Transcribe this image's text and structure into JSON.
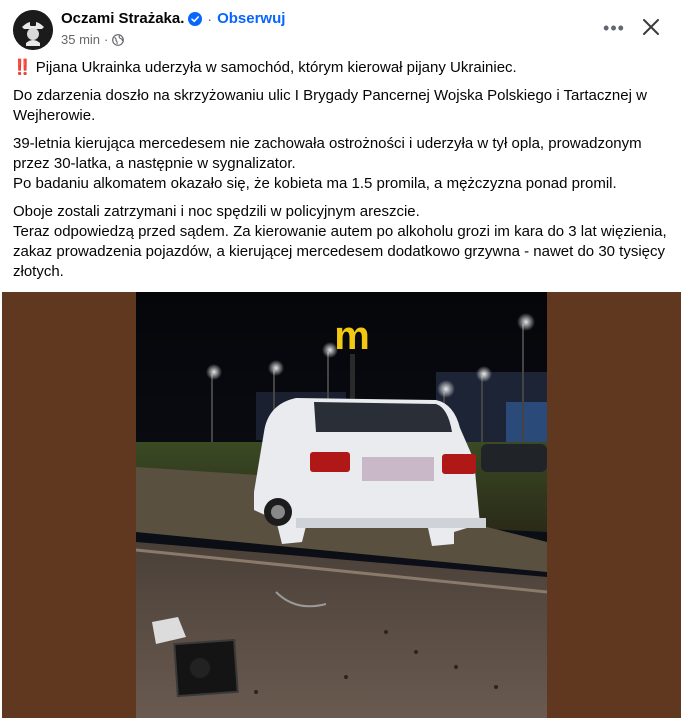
{
  "header": {
    "page_name": "Oczami Strażaka.",
    "follow_label": "Obserwuj",
    "separator": "·",
    "time": "35 min",
    "time_separator": "·",
    "verified_icon": "verified-badge-icon",
    "privacy_icon": "globe-icon",
    "more_label": "•••",
    "close_icon": "close-icon"
  },
  "post": {
    "headline": "Pijana Ukrainka uderzyła w samochód, którym kierował pijany Ukrainiec.",
    "headline_icon": "‼️",
    "paragraph1": "Do zdarzenia doszło na skrzyżowaniu ulic I Brygady Pancernej Wojska Polskiego i Tartacznej w Wejherowie.",
    "paragraph2_lines": [
      "39-letnia kierująca mercedesem nie zachowała ostrożności i uderzyła w tył opla, prowadzonym przez 30-latka, a następnie w sygnalizator.",
      "Po badaniu alkomatem okazało się, że kobieta ma 1.5 promila, a mężczyzna ponad promil."
    ],
    "paragraph3_lines": [
      "Oboje zostali zatrzymani i noc spędzili w policyjnym areszcie.",
      "Teraz odpowiedzą przed sądem. Za kierowanie autem po alkoholu grozi im kara do 3 lat więzienia, zakaz prowadzenia pojazdów, a kierującej mercedesem dodatkowo grzywna - nawet do 30 tysięcy złotych."
    ]
  },
  "colors": {
    "accent": "#0866ff",
    "secondary_text": "#65676b",
    "media_background": "#603820",
    "logo_sign": "#f2c811"
  }
}
